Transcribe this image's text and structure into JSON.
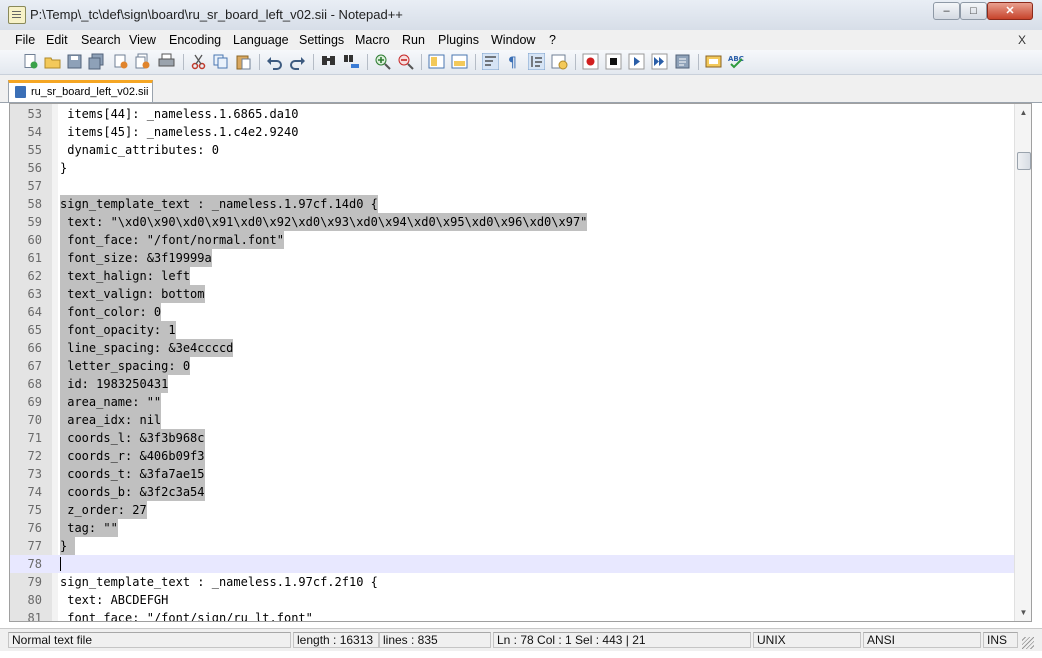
{
  "window": {
    "title": "P:\\Temp\\_tc\\def\\sign\\board\\ru_sr_board_left_v02.sii - Notepad++",
    "controls": {
      "minimize": "–",
      "maximize": "□",
      "close": "✕"
    }
  },
  "menu": {
    "items": [
      "File",
      "Edit",
      "Search",
      "View",
      "Encoding",
      "Language",
      "Settings",
      "Macro",
      "Run",
      "Plugins",
      "Window",
      "?"
    ],
    "close_doc": "X"
  },
  "toolbar": {
    "buttons": [
      "new-file",
      "open-file",
      "save",
      "save-all",
      "close",
      "close-all",
      "print",
      "cut",
      "copy",
      "paste",
      "undo",
      "redo",
      "find",
      "replace",
      "zoom-in",
      "zoom-out",
      "sync-vertical",
      "sync-horizontal",
      "word-wrap",
      "show-all-chars",
      "indent-guide",
      "user-define-lang",
      "record-macro",
      "stop-record",
      "play-macro",
      "run-multiple",
      "save-macro",
      "doc-map",
      "spell-check"
    ]
  },
  "tab": {
    "label": "ru_sr_board_left_v02.sii",
    "icon": "save-disk-icon"
  },
  "editor": {
    "lines": [
      {
        "num": "53",
        "text": " items[44]: _nameless.1.6865.da10",
        "selected": false
      },
      {
        "num": "54",
        "text": " items[45]: _nameless.1.c4e2.9240",
        "selected": false
      },
      {
        "num": "55",
        "text": " dynamic_attributes: 0",
        "selected": false
      },
      {
        "num": "56",
        "text": "}",
        "selected": false
      },
      {
        "num": "57",
        "text": "",
        "selected": false
      },
      {
        "num": "58",
        "text": "sign_template_text : _nameless.1.97cf.14d0 {",
        "selected": true
      },
      {
        "num": "59",
        "text": " text: \"\\xd0\\x90\\xd0\\x91\\xd0\\x92\\xd0\\x93\\xd0\\x94\\xd0\\x95\\xd0\\x96\\xd0\\x97\"",
        "selected": true
      },
      {
        "num": "60",
        "text": " font_face: \"/font/normal.font\"",
        "selected": true
      },
      {
        "num": "61",
        "text": " font_size: &3f19999a",
        "selected": true
      },
      {
        "num": "62",
        "text": " text_halign: left",
        "selected": true
      },
      {
        "num": "63",
        "text": " text_valign: bottom",
        "selected": true
      },
      {
        "num": "64",
        "text": " font_color: 0",
        "selected": true
      },
      {
        "num": "65",
        "text": " font_opacity: 1",
        "selected": true
      },
      {
        "num": "66",
        "text": " line_spacing: &3e4ccccd",
        "selected": true
      },
      {
        "num": "67",
        "text": " letter_spacing: 0",
        "selected": true
      },
      {
        "num": "68",
        "text": " id: 1983250431",
        "selected": true
      },
      {
        "num": "69",
        "text": " area_name: \"\"",
        "selected": true
      },
      {
        "num": "70",
        "text": " area_idx: nil",
        "selected": true
      },
      {
        "num": "71",
        "text": " coords_l: &3f3b968c",
        "selected": true
      },
      {
        "num": "72",
        "text": " coords_r: &406b09f3",
        "selected": true
      },
      {
        "num": "73",
        "text": " coords_t: &3fa7ae15",
        "selected": true
      },
      {
        "num": "74",
        "text": " coords_b: &3f2c3a54",
        "selected": true
      },
      {
        "num": "75",
        "text": " z_order: 27",
        "selected": true
      },
      {
        "num": "76",
        "text": " tag: \"\"",
        "selected": true
      },
      {
        "num": "77",
        "text": "}",
        "selected": true
      },
      {
        "num": "78",
        "text": "",
        "selected": false,
        "current": true
      },
      {
        "num": "79",
        "text": "sign_template_text : _nameless.1.97cf.2f10 {",
        "selected": false
      },
      {
        "num": "80",
        "text": " text: ABCDEFGH",
        "selected": false
      },
      {
        "num": "81",
        "text": " font_face: \"/font/sign/ru_lt.font\"",
        "selected": false
      }
    ]
  },
  "status": {
    "file_type": "Normal text file",
    "length": "length : 16313",
    "lines": "lines : 835",
    "position": "Ln : 78    Col : 1    Sel : 443 | 21",
    "eol": "UNIX",
    "encoding": "ANSI",
    "mode": "INS"
  },
  "colors": {
    "selection": "#c0c0c0",
    "current_line": "#e8e8ff",
    "tab_accent": "#f5a623",
    "gutter": "#e4e4e4"
  }
}
